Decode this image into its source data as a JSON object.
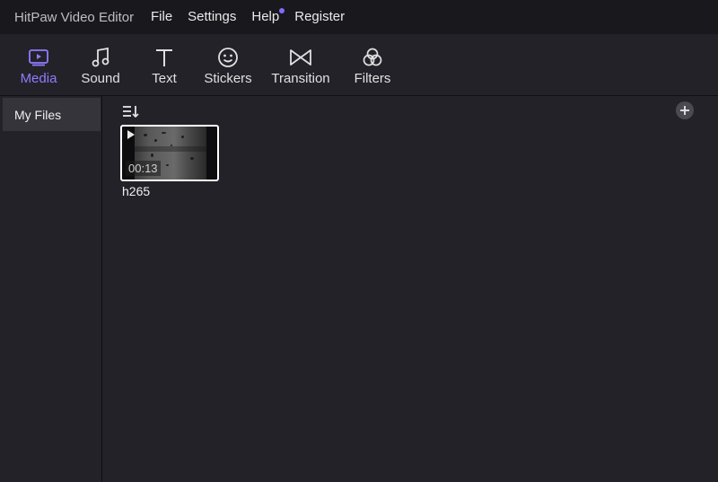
{
  "app": {
    "title": "HitPaw Video Editor"
  },
  "menu": {
    "items": [
      {
        "label": "File"
      },
      {
        "label": "Settings"
      },
      {
        "label": "Help"
      },
      {
        "label": "Register"
      }
    ]
  },
  "toolbar": {
    "tabs": [
      {
        "label": "Media",
        "icon": "media-icon",
        "active": true
      },
      {
        "label": "Sound",
        "icon": "music-note-icon",
        "active": false
      },
      {
        "label": "Text",
        "icon": "text-t-icon",
        "active": false
      },
      {
        "label": "Stickers",
        "icon": "smiley-icon",
        "active": false
      },
      {
        "label": "Transition",
        "icon": "bowtie-icon",
        "active": false
      },
      {
        "label": "Filters",
        "icon": "circles-icon",
        "active": false
      }
    ],
    "accent_color": "#8f7cff"
  },
  "sidebar": {
    "items": [
      {
        "label": "My Files",
        "selected": true
      }
    ]
  },
  "content": {
    "sort_icon": "sort-icon",
    "add_icon": "plus-icon",
    "media": [
      {
        "name": "h265",
        "duration": "00:13"
      }
    ]
  }
}
